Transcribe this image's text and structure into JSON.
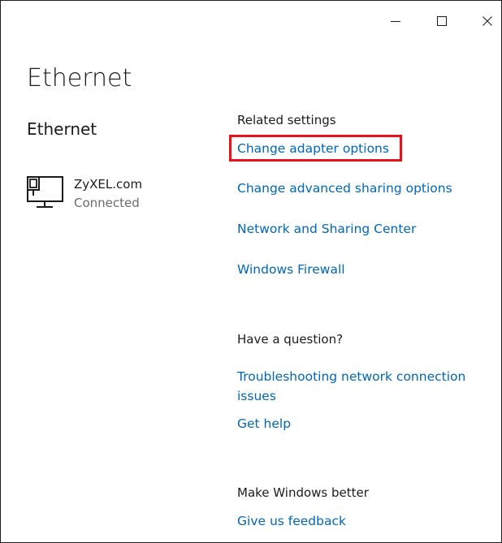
{
  "window": {
    "page_title": "Ethernet",
    "controls": {
      "minimize_icon": "minimize-icon",
      "maximize_icon": "maximize-icon",
      "close_icon": "close-icon"
    }
  },
  "left": {
    "section_title": "Ethernet",
    "adapter": {
      "icon": "ethernet-network-icon",
      "name": "ZyXEL.com",
      "status": "Connected"
    }
  },
  "related_settings": {
    "heading": "Related settings",
    "links": [
      "Change adapter options",
      "Change advanced sharing options",
      "Network and Sharing Center",
      "Windows Firewall"
    ]
  },
  "question": {
    "heading": "Have a question?",
    "links": [
      "Troubleshooting network connection issues",
      "Get help"
    ]
  },
  "feedback": {
    "heading": "Make Windows better",
    "link": "Give us feedback"
  },
  "colors": {
    "link": "#0067b8",
    "highlight": "#e8131a",
    "secondary_text": "#6b6b6b"
  }
}
